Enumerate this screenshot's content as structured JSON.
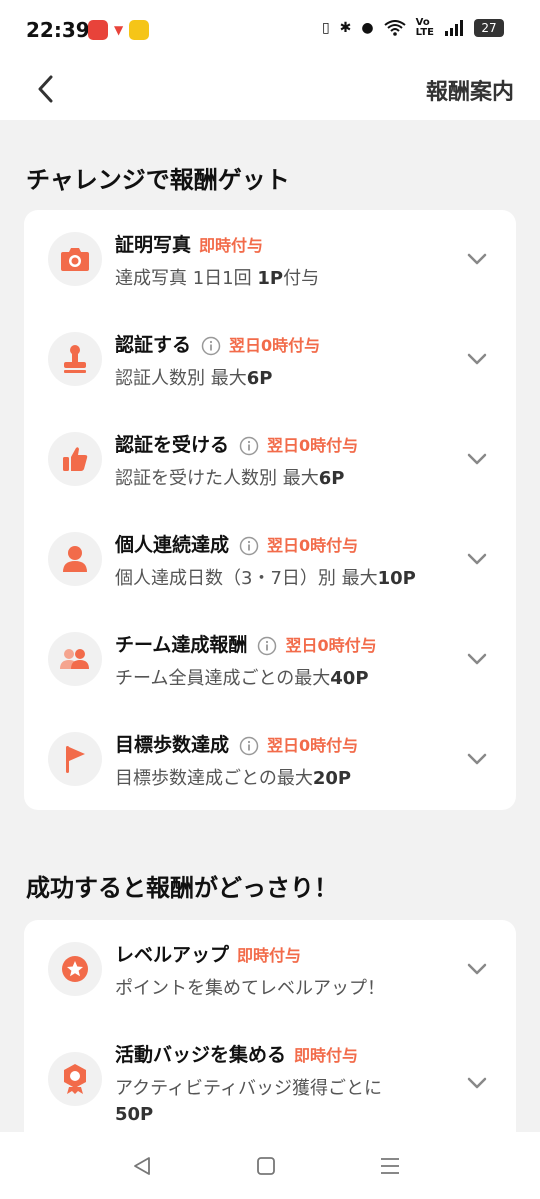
{
  "status_bar": {
    "time": "22:39",
    "battery_level": "27",
    "icons": [
      "news-app-icon",
      "notification-app-icon",
      "yellow-app-icon",
      "vibrate-icon",
      "bluetooth-icon",
      "location-icon",
      "wifi-icon",
      "volte-icon",
      "signal-icon",
      "battery-icon"
    ]
  },
  "header": {
    "back_icon": "chevron-left-icon",
    "title": "報酬案内"
  },
  "sections": [
    {
      "title": "チャレンジで報酬ゲット",
      "items": [
        {
          "icon": "camera-icon",
          "name": "証明写真",
          "has_info": false,
          "badge": "即時付与",
          "desc_prefix": "達成写真 1日1回 ",
          "desc_bold": "1P",
          "desc_suffix": "付与"
        },
        {
          "icon": "stamp-icon",
          "name": "認証する",
          "has_info": true,
          "badge": "翌日0時付与",
          "desc_prefix": "認証人数別 最大",
          "desc_bold": "6P",
          "desc_suffix": ""
        },
        {
          "icon": "thumbs-up-icon",
          "name": "認証を受ける",
          "has_info": true,
          "badge": "翌日0時付与",
          "desc_prefix": "認証を受けた人数別 最大",
          "desc_bold": "6P",
          "desc_suffix": ""
        },
        {
          "icon": "person-icon",
          "name": "個人連続達成",
          "has_info": true,
          "badge": "翌日0時付与",
          "desc_prefix": "個人達成日数（3・7日）別 最大",
          "desc_bold": "10P",
          "desc_suffix": ""
        },
        {
          "icon": "group-icon",
          "name": "チーム達成報酬",
          "has_info": true,
          "badge": "翌日0時付与",
          "desc_prefix": "チーム全員達成ごとの最大",
          "desc_bold": "40P",
          "desc_suffix": ""
        },
        {
          "icon": "flag-icon",
          "name": "目標歩数達成",
          "has_info": true,
          "badge": "翌日0時付与",
          "desc_prefix": "目標歩数達成ごとの最大",
          "desc_bold": "20P",
          "desc_suffix": ""
        }
      ]
    },
    {
      "title": "成功すると報酬がどっさり！",
      "items": [
        {
          "icon": "star-badge-icon",
          "name": "レベルアップ",
          "has_info": false,
          "badge": "即時付与",
          "desc_prefix": "ポイントを集めてレベルアップ！",
          "desc_bold": "",
          "desc_suffix": ""
        },
        {
          "icon": "medal-icon",
          "name": "活動バッジを集める",
          "has_info": false,
          "badge": "即時付与",
          "desc_prefix": "アクティビティバッジ獲得ごとに",
          "desc_bold": "50P",
          "desc_suffix": ""
        }
      ]
    }
  ],
  "nav_bar": {
    "buttons": [
      "back-triangle-icon",
      "home-square-icon",
      "recents-menu-icon"
    ]
  },
  "colors": {
    "accent": "#f26b4a",
    "background": "#f2f2f2",
    "card": "#ffffff",
    "icon_bg": "#f1f1f1"
  }
}
